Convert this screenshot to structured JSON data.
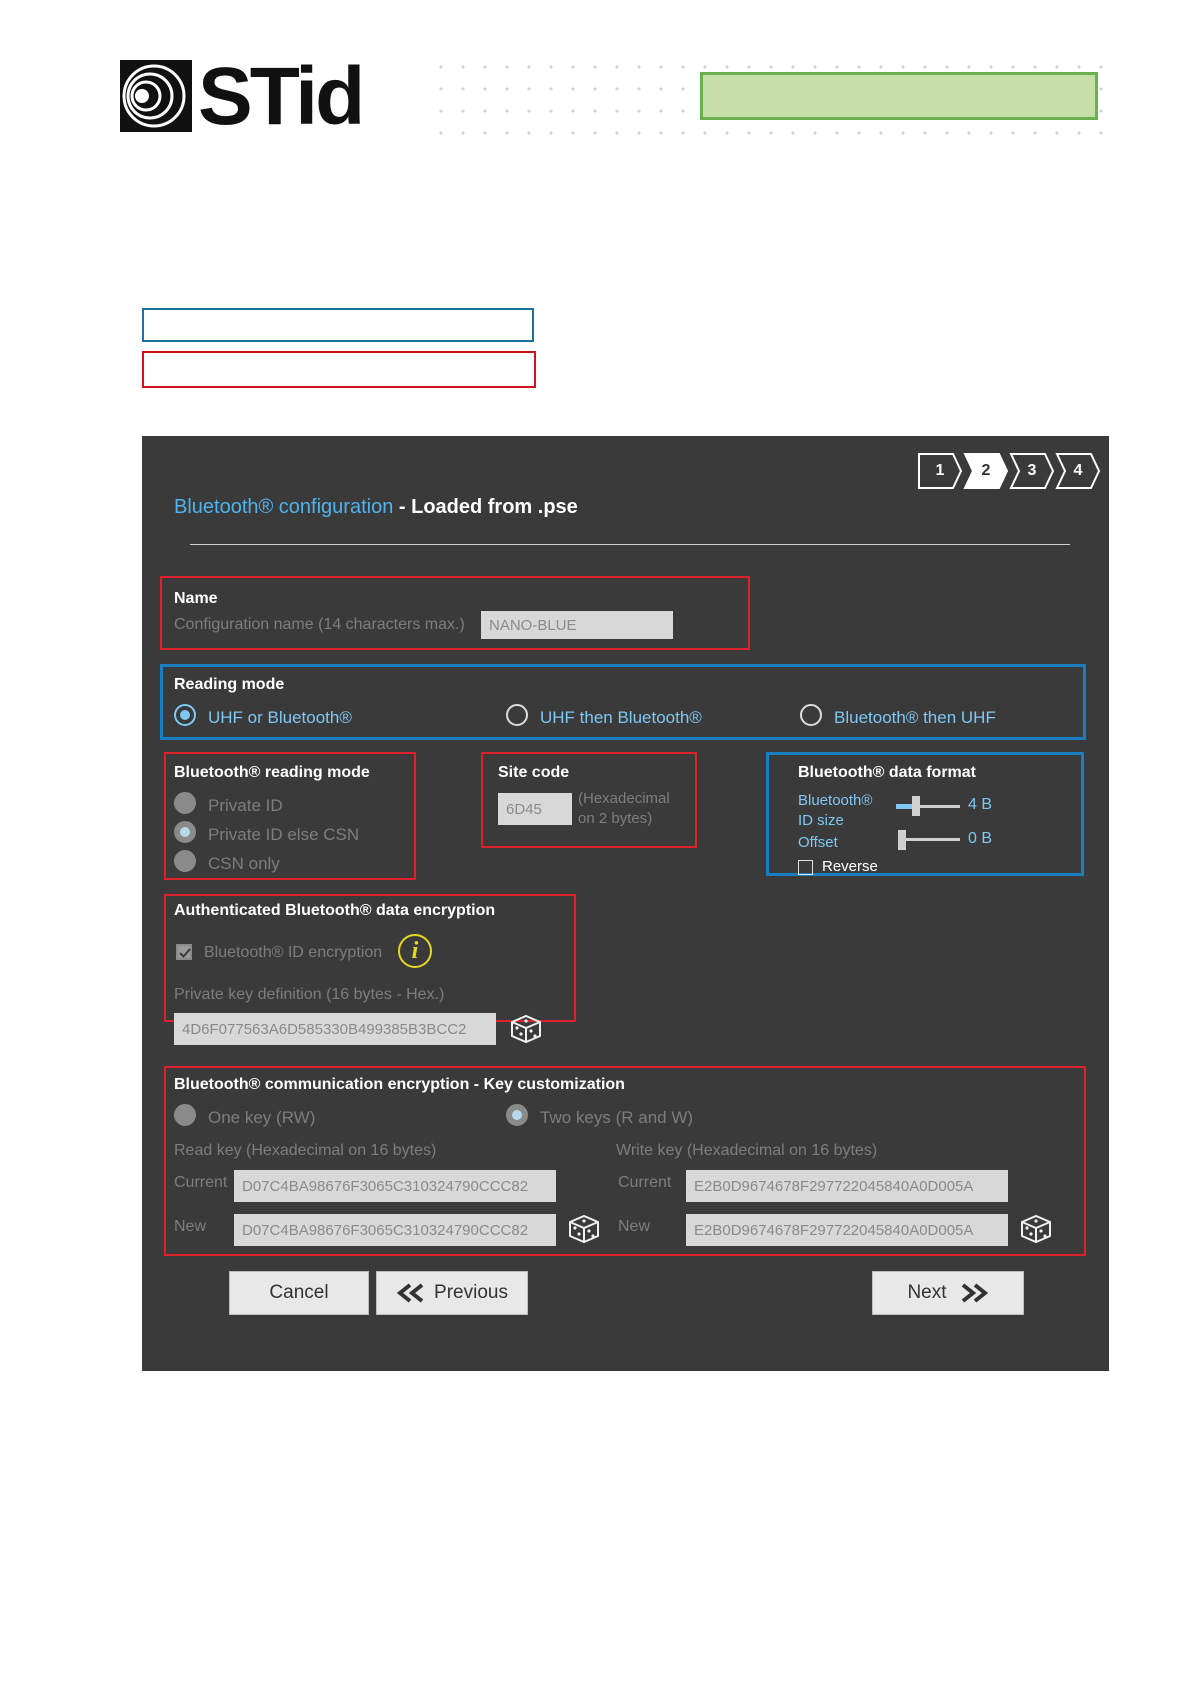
{
  "header": {
    "logo_text": "STid"
  },
  "dialog": {
    "title_prefix": "Bluetooth® configuration",
    "title_suffix": " - Loaded from .pse",
    "steps": [
      "1",
      "2",
      "3",
      "4"
    ],
    "active_step": "2",
    "name_section": {
      "title": "Name",
      "label": "Configuration name (14 characters max.)",
      "value": "NANO-BLUE"
    },
    "reading_mode": {
      "title": "Reading mode",
      "options": [
        "UHF or Bluetooth®",
        "UHF then Bluetooth®",
        "Bluetooth® then UHF"
      ],
      "selected": "UHF or Bluetooth®"
    },
    "bt_reading_mode": {
      "title": "Bluetooth® reading mode",
      "options": [
        "Private ID",
        "Private ID else CSN",
        "CSN only"
      ],
      "selected": "Private ID else CSN"
    },
    "site_code": {
      "title": "Site code",
      "value": "6D45",
      "hint_line1": "(Hexadecimal",
      "hint_line2": "on 2 bytes)"
    },
    "data_format": {
      "title": "Bluetooth® data format",
      "id_size_label_1": "Bluetooth®",
      "id_size_label_2": "ID size",
      "id_size_value": "4 B",
      "offset_label": "Offset",
      "offset_value": "0 B",
      "reverse_label": "Reverse",
      "reverse_checked": false
    },
    "auth_encryption": {
      "title": "Authenticated Bluetooth® data encryption",
      "checkbox_label": "Bluetooth® ID encryption",
      "checked": true,
      "key_label": "Private key definition (16 bytes - Hex.)",
      "key_value": "4D6F077563A6D585330B499385B3BCC2"
    },
    "comm_encryption": {
      "title": "Bluetooth® communication encryption - Key customization",
      "option_one": "One key (RW)",
      "option_two": "Two keys (R and W)",
      "selected": "Two keys (R and W)",
      "read_key_label": "Read key (Hexadecimal on 16 bytes)",
      "write_key_label": "Write key (Hexadecimal on 16 bytes)",
      "current_label": "Current",
      "new_label": "New",
      "read_current": "D07C4BA98676F3065C310324790CCC82",
      "read_new": "D07C4BA98676F3065C310324790CCC82",
      "write_current": "E2B0D9674678F297722045840A0D005A",
      "write_new": "E2B0D9674678F297722045840A0D005A"
    },
    "buttons": {
      "cancel": "Cancel",
      "previous": "Previous",
      "next": "Next"
    }
  },
  "colors": {
    "accent": "#4fb3ee",
    "dialog_bg": "#3a3a3a",
    "highlight_red": "#e0202a",
    "highlight_blue": "#1a7fc1",
    "green_box": "#c6dea8"
  }
}
